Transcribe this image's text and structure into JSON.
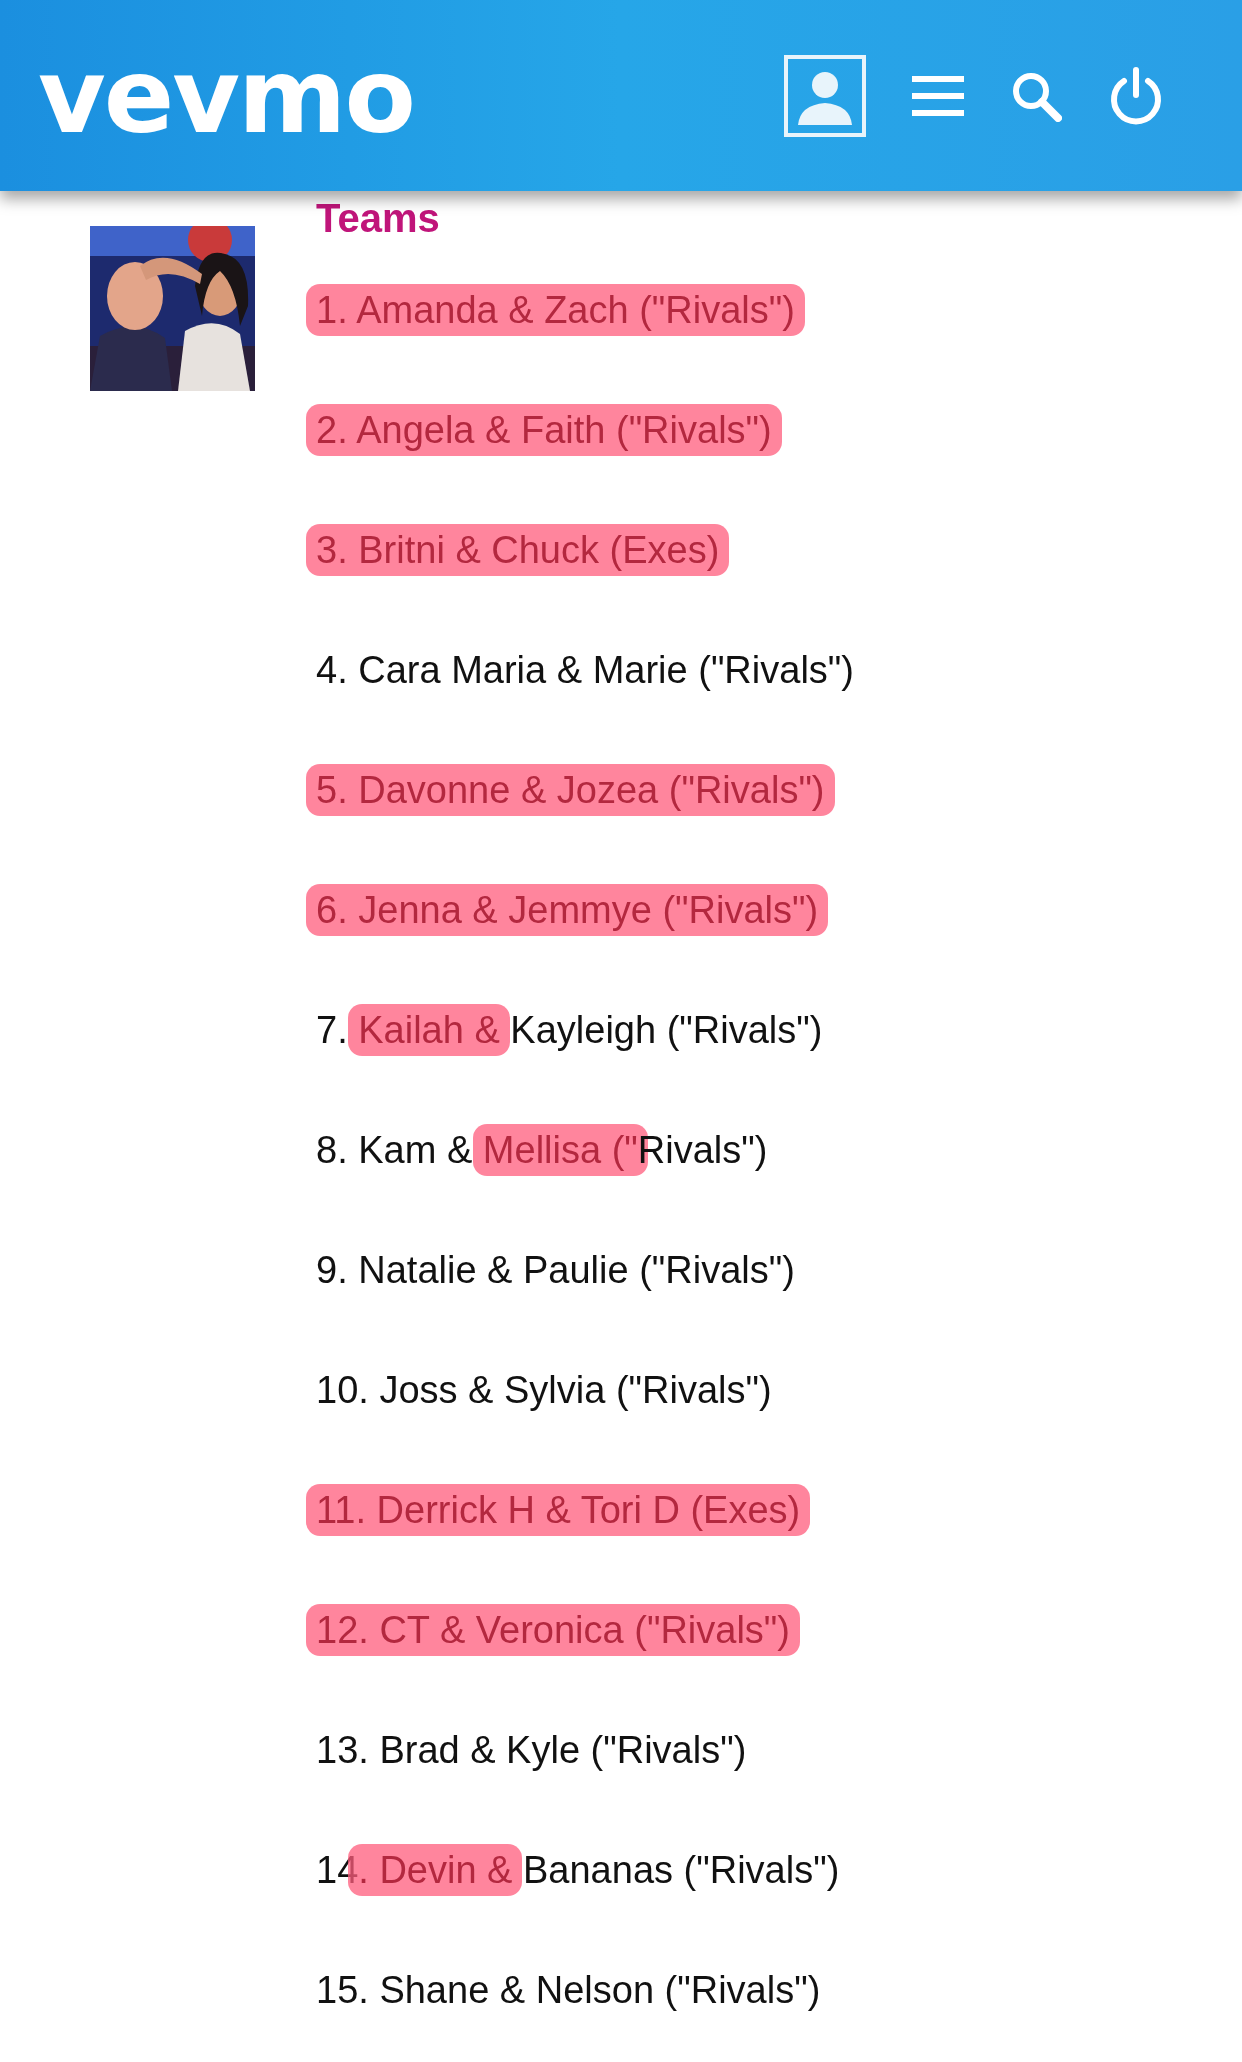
{
  "header": {
    "logo": "vevmo"
  },
  "heading": "Teams",
  "teams": [
    {
      "segments": [
        {
          "text": "1. Amanda & Zach (\"Rivals\")",
          "highlighted": true
        }
      ]
    },
    {
      "segments": [
        {
          "text": "2. Angela & Faith (\"Rivals\")",
          "highlighted": true
        }
      ]
    },
    {
      "segments": [
        {
          "text": "3. Britni & Chuck (Exes)",
          "highlighted": true
        }
      ]
    },
    {
      "segments": [
        {
          "text": "4. Cara Maria & Marie (\"Rivals\")",
          "highlighted": false
        }
      ]
    },
    {
      "segments": [
        {
          "text": "5. Davonne & Jozea (\"Rivals\")",
          "highlighted": true
        }
      ]
    },
    {
      "segments": [
        {
          "text": "6. Jenna & Jemmye (\"Rivals\")",
          "highlighted": true
        }
      ]
    },
    {
      "segments": [
        {
          "text": "7. ",
          "highlighted": false
        },
        {
          "text": "Kailah &",
          "highlighted": true
        },
        {
          "text": " Kayleigh (\"Rivals\")",
          "highlighted": false
        }
      ]
    },
    {
      "segments": [
        {
          "text": "8. Kam & ",
          "highlighted": false
        },
        {
          "text": "Mellisa (\"",
          "highlighted": true
        },
        {
          "text": "Rivals\")",
          "highlighted": false
        }
      ]
    },
    {
      "segments": [
        {
          "text": "9. Natalie & Paulie (\"Rivals\")",
          "highlighted": false
        }
      ]
    },
    {
      "segments": [
        {
          "text": "10. Joss & Sylvia (\"Rivals\")",
          "highlighted": false
        }
      ]
    },
    {
      "segments": [
        {
          "text": "11. Derrick H & Tori D (Exes)",
          "highlighted": true
        }
      ]
    },
    {
      "segments": [
        {
          "text": "12. CT & Veronica (\"Rivals\")",
          "highlighted": true
        }
      ]
    },
    {
      "segments": [
        {
          "text": "13. Brad & Kyle (\"Rivals\")",
          "highlighted": false
        }
      ]
    },
    {
      "segments": [
        {
          "text": "14",
          "highlighted": false
        },
        {
          "text": ". Devin &",
          "highlighted": true
        },
        {
          "text": " Bananas (\"Rivals\")",
          "highlighted": false
        }
      ]
    },
    {
      "segments": [
        {
          "text": "15. Shane & Nelson (\"Rivals\")",
          "highlighted": false
        }
      ]
    }
  ]
}
